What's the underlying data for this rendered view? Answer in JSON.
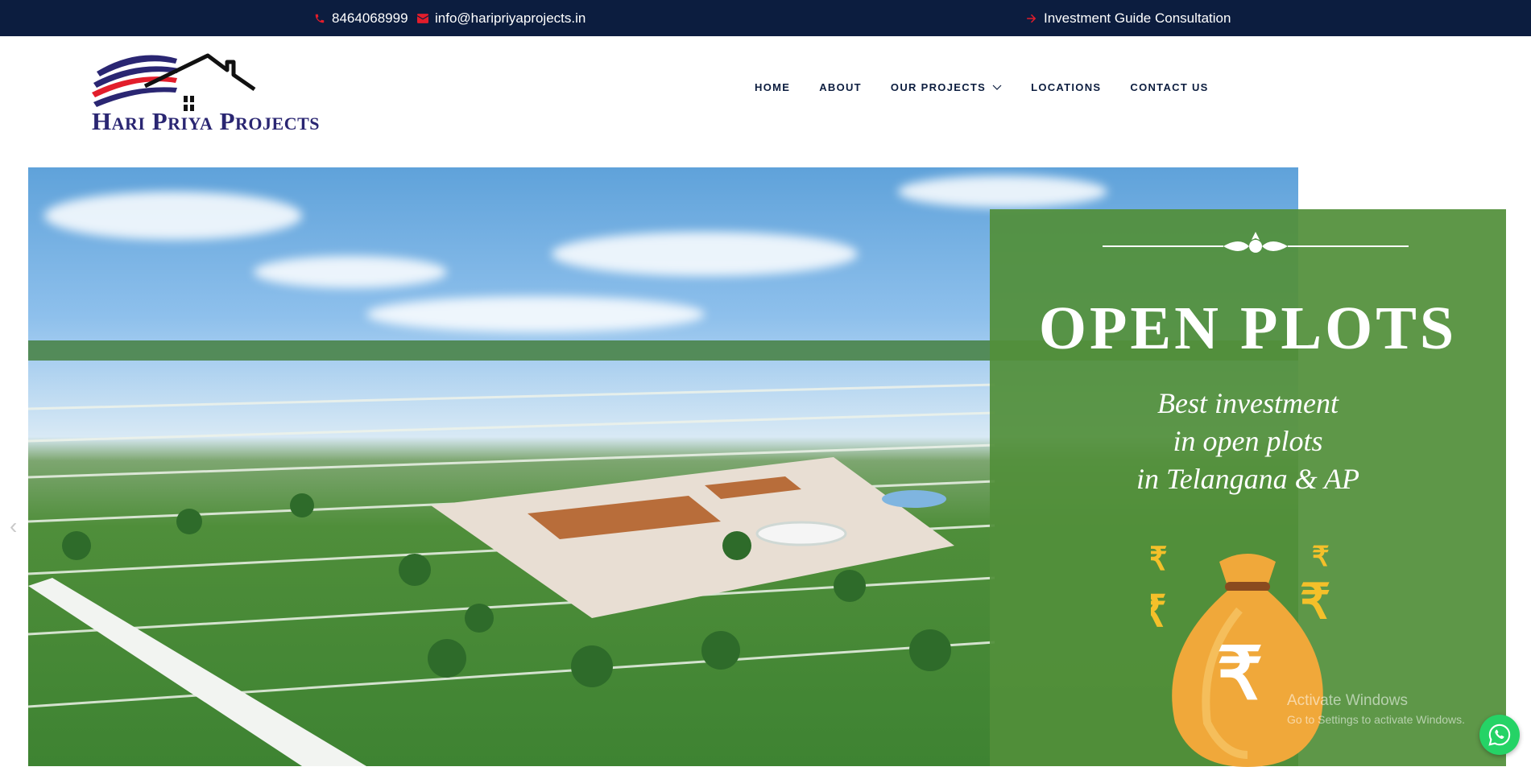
{
  "topbar": {
    "phone": "8464068999",
    "email": "info@haripriyaprojects.in",
    "consultation": "Investment Guide Consultation"
  },
  "brand": {
    "name": "Hari Priya Projects"
  },
  "nav": {
    "items": [
      {
        "label": "HOME"
      },
      {
        "label": "ABOUT"
      },
      {
        "label": "OUR PROJECTS",
        "has_dropdown": true
      },
      {
        "label": "LOCATIONS"
      },
      {
        "label": "CONTACT US"
      }
    ]
  },
  "hero": {
    "title": "OPEN PLOTS",
    "subtitle_line1": "Best investment",
    "subtitle_line2": "in open plots",
    "subtitle_line3": "in Telangana & AP",
    "icons": [
      "rupee-icon",
      "money-bag-icon"
    ]
  },
  "os_watermark": {
    "line1": "Activate Windows",
    "line2": "Go to Settings to activate Windows."
  },
  "colors": {
    "topbar_bg": "#0c1d3f",
    "accent_red": "#e21d2b",
    "brand_navy": "#2a2672",
    "panel_green": "#528f3a",
    "whatsapp_green": "#25d366"
  }
}
